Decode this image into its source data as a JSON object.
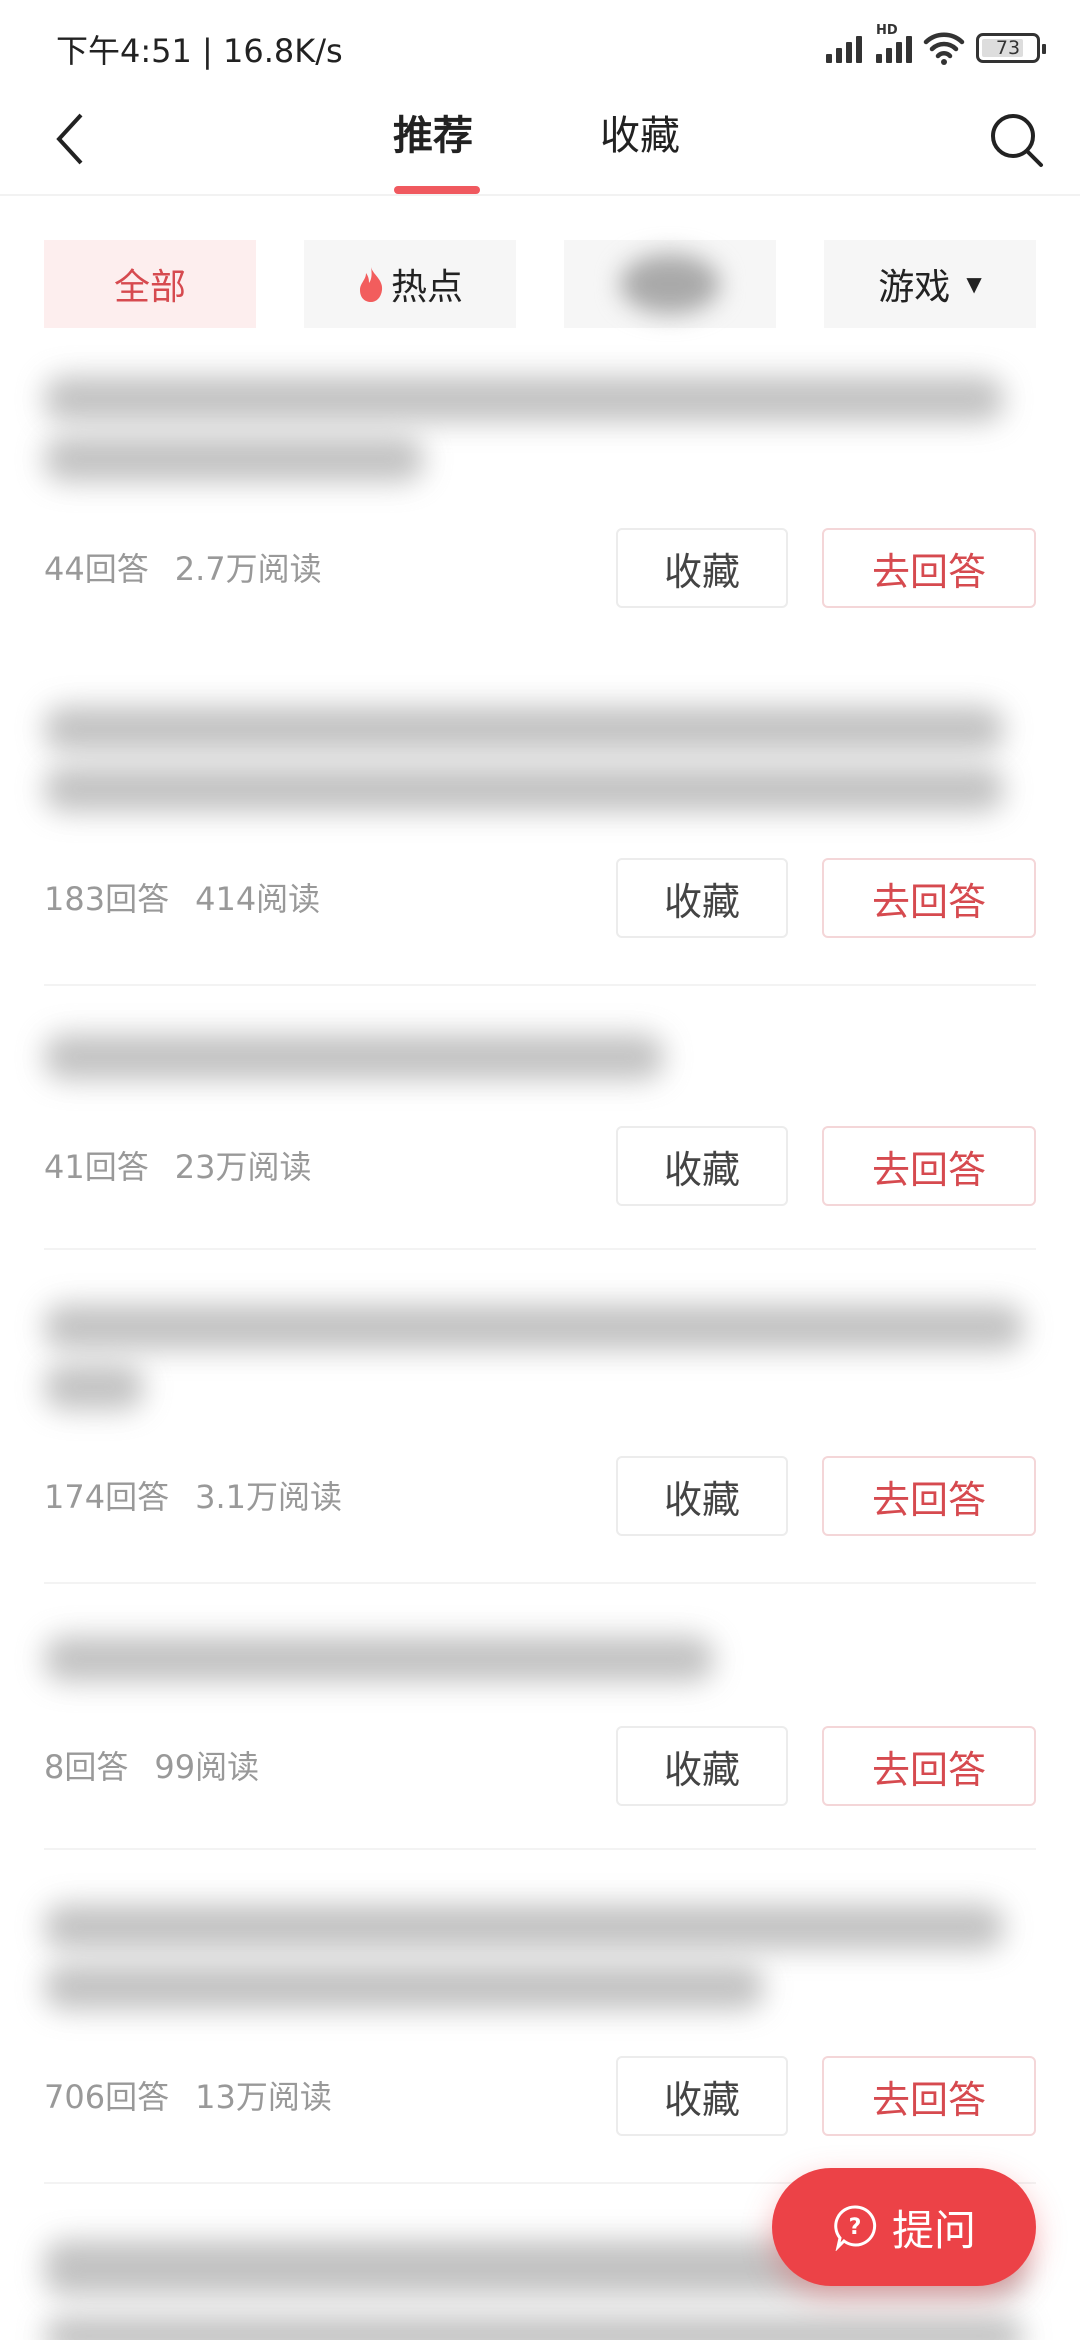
{
  "status_bar": {
    "time_speed": "下午4:51 | 16.8K/s",
    "hd_label": "HD",
    "battery_level": "73"
  },
  "header": {
    "back_icon": "chevron-left-icon",
    "tabs": [
      {
        "label": "推荐",
        "active": true
      },
      {
        "label": "收藏",
        "active": false
      }
    ],
    "search_icon": "search-icon"
  },
  "filters": [
    {
      "label": "全部",
      "active": true
    },
    {
      "label": "热点",
      "icon": "flame-icon"
    },
    {
      "label": "",
      "blurred": true
    },
    {
      "label": "游戏",
      "dropdown": true
    }
  ],
  "colors": {
    "accent": "#ec4247",
    "accent_text": "#d64a4f",
    "chip_active_bg": "#fdeeee",
    "meta_text": "#999999"
  },
  "items": [
    {
      "answers": "44回答",
      "reads": "2.7万阅读",
      "fav_label": "收藏",
      "answer_label": "去回答"
    },
    {
      "answers": "183回答",
      "reads": "414阅读",
      "fav_label": "收藏",
      "answer_label": "去回答"
    },
    {
      "answers": "41回答",
      "reads": "23万阅读",
      "fav_label": "收藏",
      "answer_label": "去回答"
    },
    {
      "answers": "174回答",
      "reads": "3.1万阅读",
      "fav_label": "收藏",
      "answer_label": "去回答"
    },
    {
      "answers": "8回答",
      "reads": "99阅读",
      "fav_label": "收藏",
      "answer_label": "去回答"
    },
    {
      "answers": "706回答",
      "reads": "13万阅读",
      "fav_label": "收藏",
      "answer_label": "去回答"
    }
  ],
  "fab": {
    "label": "提问",
    "icon": "question-bubble-icon"
  }
}
